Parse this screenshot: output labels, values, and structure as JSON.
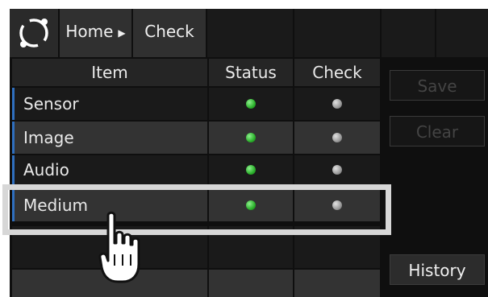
{
  "breadcrumb": {
    "home": "Home",
    "current": "Check"
  },
  "table": {
    "headers": {
      "item": "Item",
      "status": "Status",
      "check": "Check"
    },
    "rows": [
      {
        "name": "Sensor",
        "status": "green",
        "check": "gray"
      },
      {
        "name": "Image",
        "status": "green",
        "check": "gray"
      },
      {
        "name": "Audio",
        "status": "green",
        "check": "gray"
      },
      {
        "name": "Medium",
        "status": "green",
        "check": "gray",
        "highlighted": true
      }
    ]
  },
  "buttons": {
    "save": "Save",
    "clear": "Clear",
    "history": "History"
  },
  "colors": {
    "accent": "#2f6fbf",
    "ok": "#2bb02b",
    "idle": "#9a9a9a",
    "highlight": "#d7d7d7"
  }
}
